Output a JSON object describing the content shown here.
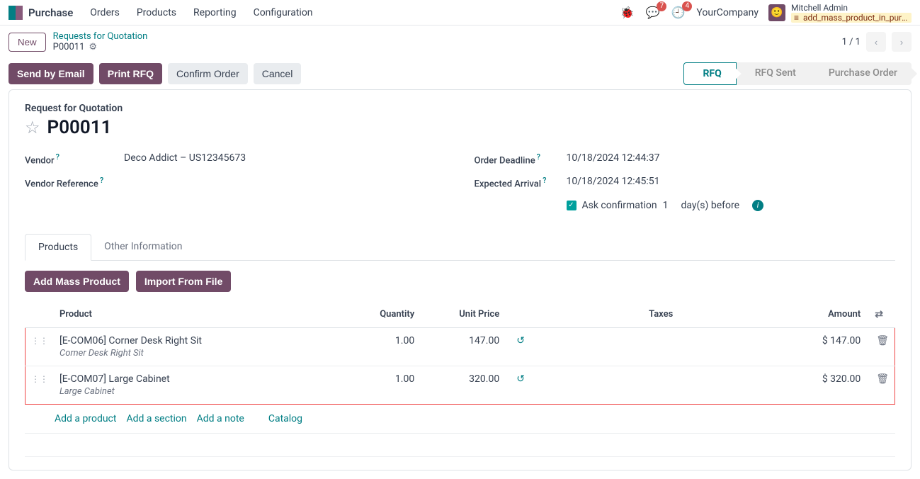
{
  "nav": {
    "app": "Purchase",
    "links": [
      "Orders",
      "Products",
      "Reporting",
      "Configuration"
    ],
    "messages_badge": "7",
    "activities_badge": "4",
    "company": "YourCompany",
    "user_name": "Mitchell Admin",
    "db_name": "add_mass_product_in_purc…"
  },
  "breadcrumb": {
    "new_label": "New",
    "parent": "Requests for Quotation",
    "current": "P00011",
    "pager": "1 / 1"
  },
  "actions": {
    "send_email": "Send by Email",
    "print_rfq": "Print RFQ",
    "confirm": "Confirm Order",
    "cancel": "Cancel"
  },
  "status_steps": {
    "rfq": "RFQ",
    "rfq_sent": "RFQ Sent",
    "po": "Purchase Order"
  },
  "form": {
    "heading": "Request for Quotation",
    "title": "P00011",
    "vendor_label": "Vendor",
    "vendor_value": "Deco Addict – US12345673",
    "vendor_ref_label": "Vendor Reference",
    "deadline_label": "Order Deadline",
    "deadline_value": "10/18/2024 12:44:37",
    "expected_label": "Expected Arrival",
    "expected_value": "10/18/2024 12:45:51",
    "ask_confirm_label": "Ask confirmation",
    "ask_confirm_days": "1",
    "days_before": "day(s) before"
  },
  "tabs": {
    "products": "Products",
    "other": "Other Information"
  },
  "tab_actions": {
    "add_mass": "Add Mass Product",
    "import_file": "Import From File"
  },
  "table": {
    "cols": {
      "product": "Product",
      "qty": "Quantity",
      "price": "Unit Price",
      "taxes": "Taxes",
      "amount": "Amount"
    },
    "rows": [
      {
        "sku": "[E-COM06] Corner Desk Right Sit",
        "desc": "Corner Desk Right Sit",
        "qty": "1.00",
        "price": "147.00",
        "amount": "$ 147.00"
      },
      {
        "sku": "[E-COM07] Large Cabinet",
        "desc": "Large Cabinet",
        "qty": "1.00",
        "price": "320.00",
        "amount": "$ 320.00"
      }
    ],
    "addlinks": {
      "product": "Add a product",
      "section": "Add a section",
      "note": "Add a note",
      "catalog": "Catalog"
    }
  }
}
